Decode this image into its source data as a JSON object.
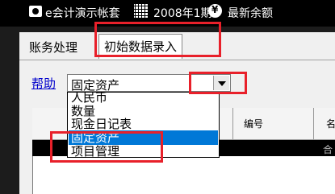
{
  "topbar": {
    "account": "e会计演示帐套",
    "period": "2008年1期",
    "balance": "最新余额"
  },
  "tabs": [
    {
      "label": "账务处理"
    },
    {
      "label": "初始数据录入"
    }
  ],
  "toolbar": {
    "help_label": "帮助"
  },
  "combo": {
    "value": "固定资产",
    "options": [
      "人民币",
      "数量",
      "现金日记表",
      "固定资产",
      "项目管理"
    ],
    "selected_index": 3
  },
  "grid": {
    "columns": [
      "编号",
      "名"
    ],
    "row_cell": "合"
  },
  "annotations": {
    "color": "#e8202a"
  }
}
